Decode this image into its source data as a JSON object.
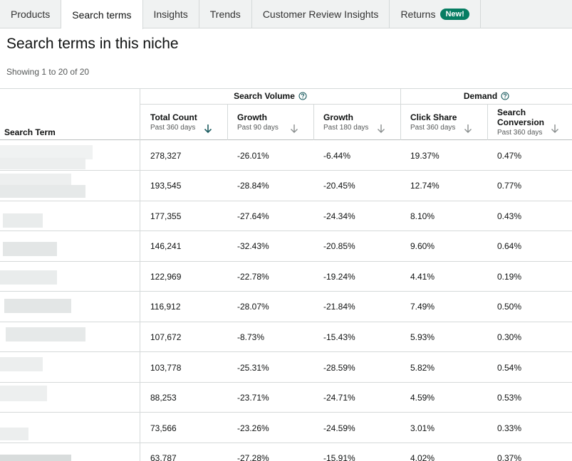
{
  "tabs": [
    {
      "label": "Products"
    },
    {
      "label": "Search terms"
    },
    {
      "label": "Insights"
    },
    {
      "label": "Trends"
    },
    {
      "label": "Customer Review Insights"
    },
    {
      "label": "Returns",
      "badge": "New!"
    }
  ],
  "active_tab": "Search terms",
  "page": {
    "title": "Search terms in this niche",
    "showing": "Showing 1 to 20 of 20"
  },
  "table": {
    "groups": {
      "search_volume": "Search Volume",
      "demand": "Demand"
    },
    "term_header": "Search Term",
    "columns": [
      {
        "label": "Total Count",
        "sub": "Past 360 days"
      },
      {
        "label": "Growth",
        "sub": "Past 90 days"
      },
      {
        "label": "Growth",
        "sub": "Past 180 days"
      },
      {
        "label": "Click Share",
        "sub": "Past 360 days"
      },
      {
        "label": "Search Conversion",
        "sub": "Past 360 days"
      }
    ],
    "rows": [
      [
        "278,327",
        "-26.01%",
        "-6.44%",
        "19.37%",
        "0.47%"
      ],
      [
        "193,545",
        "-28.84%",
        "-20.45%",
        "12.74%",
        "0.77%"
      ],
      [
        "177,355",
        "-27.64%",
        "-24.34%",
        "8.10%",
        "0.43%"
      ],
      [
        "146,241",
        "-32.43%",
        "-20.85%",
        "9.60%",
        "0.64%"
      ],
      [
        "122,969",
        "-22.78%",
        "-19.24%",
        "4.41%",
        "0.19%"
      ],
      [
        "116,912",
        "-28.07%",
        "-21.84%",
        "7.49%",
        "0.50%"
      ],
      [
        "107,672",
        "-8.73%",
        "-15.43%",
        "5.93%",
        "0.30%"
      ],
      [
        "103,778",
        "-25.31%",
        "-28.59%",
        "5.82%",
        "0.54%"
      ],
      [
        "88,253",
        "-23.71%",
        "-24.71%",
        "4.59%",
        "0.53%"
      ],
      [
        "73,566",
        "-23.26%",
        "-24.59%",
        "3.01%",
        "0.33%"
      ],
      [
        "63,787",
        "-27.28%",
        "-15.91%",
        "4.02%",
        "0.37%"
      ]
    ]
  },
  "icons": {
    "help": "help-circle-icon",
    "sort": "sort-down-arrow-icon"
  },
  "colors": {
    "badge": "#067d62",
    "sort_arrow": "#1d5d61",
    "help": "#1d5d61"
  }
}
